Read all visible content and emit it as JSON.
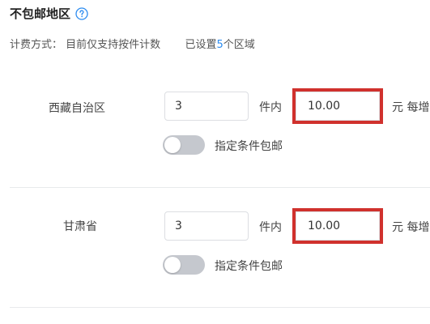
{
  "header": {
    "title": "不包邮地区",
    "help_icon": "question-circle-icon"
  },
  "subtitle": {
    "method_label": "计费方式：",
    "method_value": "目前仅支持按件计数",
    "configured_prefix": "已设置",
    "configured_count": "5",
    "configured_suffix": "个区域"
  },
  "colors": {
    "accent": "#2d8cf0",
    "highlight_box": "#d0312d",
    "toggle_off": "#c5c8ce"
  },
  "regions": [
    {
      "name": "西藏自治区",
      "quantity": "3",
      "unit_label": "件内",
      "price": "10.00",
      "tail_label": "元 每增",
      "toggle_label": "指定条件包邮",
      "toggle_on": false
    },
    {
      "name": "甘肃省",
      "quantity": "3",
      "unit_label": "件内",
      "price": "10.00",
      "tail_label": "元 每增",
      "toggle_label": "指定条件包邮",
      "toggle_on": false
    }
  ]
}
